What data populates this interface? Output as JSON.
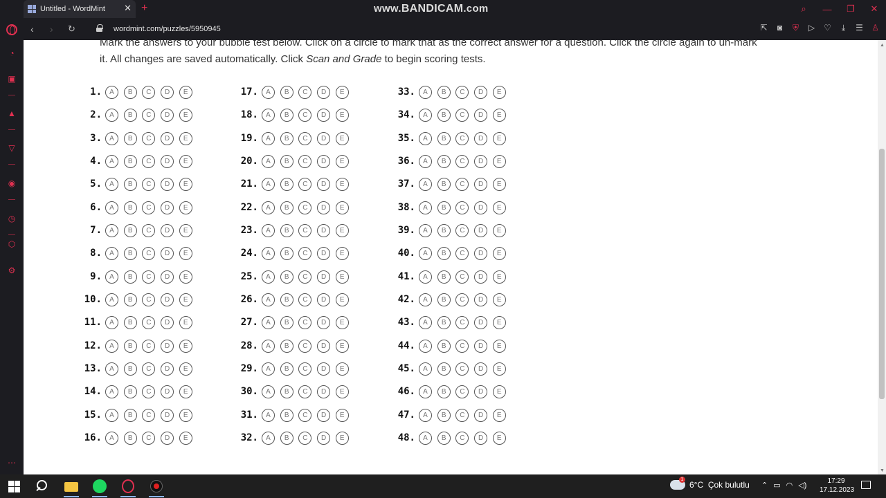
{
  "browser": {
    "tab_title": "Untitled - WordMint",
    "tab_close": "✕",
    "new_tab": "+",
    "watermark_prefix": "www.",
    "watermark_brand": "BANDICAM",
    "watermark_suffix": ".com",
    "url": "wordmint.com/puzzles/5950945",
    "accent_color": "#e03050"
  },
  "page": {
    "instructions_line1": "Mark the answers to your bubble test below. Click on a circle to mark that as the correct answer for a question. Click the circle again to un-mark",
    "instructions_line2_a": "it. All changes are saved automatically. Click ",
    "instructions_line2_em": "Scan and Grade",
    "instructions_line2_b": " to begin scoring tests.",
    "options": [
      "A",
      "B",
      "C",
      "D",
      "E"
    ],
    "questions": [
      "1.",
      "2.",
      "3.",
      "4.",
      "5.",
      "6.",
      "7.",
      "8.",
      "9.",
      "10.",
      "11.",
      "12.",
      "13.",
      "14.",
      "15.",
      "16.",
      "17.",
      "18.",
      "19.",
      "20.",
      "21.",
      "22.",
      "23.",
      "24.",
      "25.",
      "26.",
      "27.",
      "28.",
      "29.",
      "30.",
      "31.",
      "32.",
      "33.",
      "34.",
      "35.",
      "36.",
      "37.",
      "38.",
      "39.",
      "40.",
      "41.",
      "42.",
      "43.",
      "44.",
      "45.",
      "46.",
      "47.",
      "48."
    ]
  },
  "taskbar": {
    "temperature": "6°C",
    "weather": "Çok bulutlu",
    "weather_badge": "1",
    "time": "17:29",
    "date": "17.12.2023"
  }
}
